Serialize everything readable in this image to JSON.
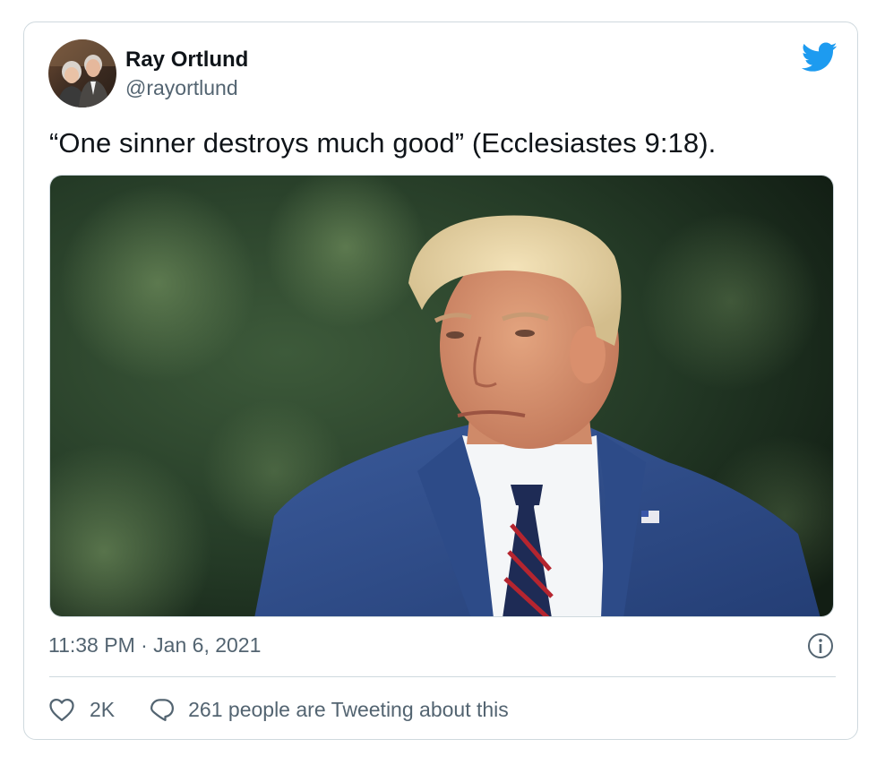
{
  "tweet": {
    "author_name": "Ray Ortlund",
    "author_handle": "@rayortlund",
    "text": "“One sinner destroys much good” (Ecclesiastes 9:18).",
    "timestamp": "11:38 PM · Jan 6, 2021",
    "likes": "2K",
    "replies_text": "261 people are Tweeting about this"
  },
  "icons": {
    "brand": "twitter-bird-icon",
    "info": "info-icon",
    "like": "heart-icon",
    "reply": "speech-bubble-icon"
  },
  "colors": {
    "twitter_blue": "#1d9bf0",
    "text_primary": "#0f1419",
    "text_secondary": "#536471",
    "border": "#cfd9de"
  }
}
